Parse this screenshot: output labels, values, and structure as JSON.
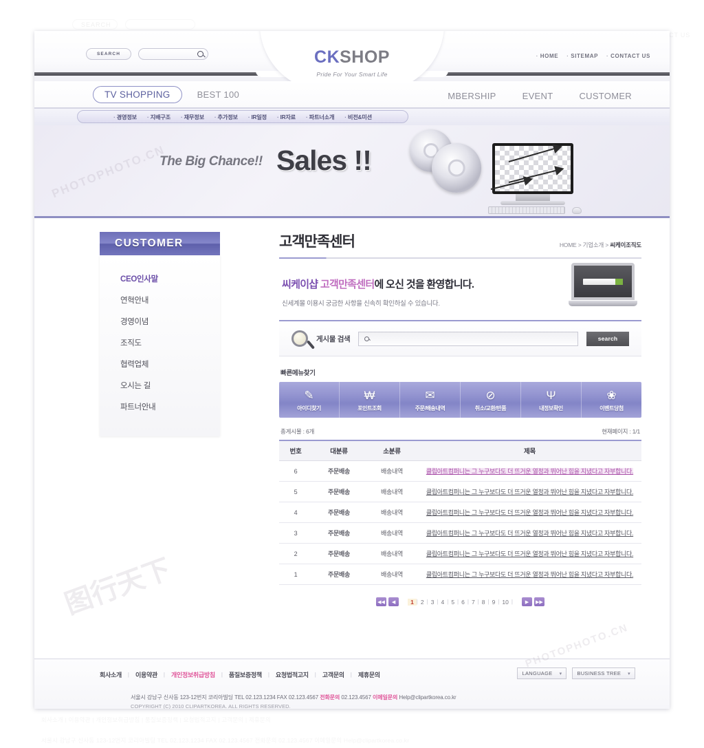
{
  "header": {
    "search_pill": "SEARCH",
    "search_value": "",
    "logo_ck": "CK",
    "logo_shop": "SHOP",
    "tagline": "Pride For Your Smart Life",
    "top_links": [
      "HOME",
      "SITEMAP",
      "CONTACT US"
    ]
  },
  "nav": {
    "active_tab": "TV SHOPPING",
    "left_items": [
      "BEST 100"
    ],
    "right_items": [
      "MBERSHIP",
      "EVENT",
      "CUSTOMER"
    ],
    "subnav": [
      "경영정보",
      "지배구조",
      "재무정보",
      "추가정보",
      "IR일정",
      "IR자료",
      "파트너소개",
      "비전&미션"
    ]
  },
  "banner": {
    "text1": "The Big Chance!!",
    "text2": "Sales !!"
  },
  "sidebar": {
    "title": "CUSTOMER",
    "items": [
      {
        "label": "CEO인사말",
        "active": true
      },
      {
        "label": "연혁안내",
        "active": false
      },
      {
        "label": "경영이념",
        "active": false
      },
      {
        "label": "조직도",
        "active": false
      },
      {
        "label": "협력업체",
        "active": false
      },
      {
        "label": "오시는 길",
        "active": false
      },
      {
        "label": "파트너안내",
        "active": false
      }
    ]
  },
  "main": {
    "page_title": "고객만족센터",
    "breadcrumb_home": "HOME",
    "breadcrumb_mid": "기업소개",
    "breadcrumb_last": "씨케이조직도",
    "welcome_a": "씨케이샵 ",
    "welcome_b": "고객만족센터",
    "welcome_c": "에 오신 것을 환영합니다.",
    "welcome_sub": "신세계몰 이용시 궁금한 사항을 신속히 확인하실 수 있습니다.",
    "search_label": "게시물 검색",
    "search_value": "",
    "search_button": "search",
    "quick_label": "빠른메뉴찾기",
    "quick_menu": [
      {
        "icon": "document-pencil-icon",
        "glyph": "✎",
        "label": "아이디찾기"
      },
      {
        "icon": "won-point-icon",
        "glyph": "₩",
        "label": "포인트조회"
      },
      {
        "icon": "envelope-at-icon",
        "glyph": "✉",
        "label": "주문/배송내역"
      },
      {
        "icon": "no-card-icon",
        "glyph": "⊘",
        "label": "취소/교환/반품"
      },
      {
        "icon": "sprout-hands-icon",
        "glyph": "Ψ",
        "label": "내정보확인"
      },
      {
        "icon": "gift-box-icon",
        "glyph": "❀",
        "label": "이벤트당첨"
      }
    ],
    "total_label": "총게시물 : 6개",
    "page_label": "현재페이지 : 1/1",
    "table": {
      "headers": [
        "번호",
        "대분류",
        "소분류",
        "제목"
      ],
      "rows": [
        {
          "no": "6",
          "cat": "주문배송",
          "sub": "배송내역",
          "title": "클립아트컴퍼니는 그 누구보다도 더 뜨거운 열정과 뛰어난 힘을 지녔다고 자부합니다.",
          "highlight": true
        },
        {
          "no": "5",
          "cat": "주문배송",
          "sub": "배송내역",
          "title": "클립아트컴퍼니는 그 누구보다도 더 뜨거운 열정과 뛰어난 힘을 지녔다고 자부합니다.",
          "highlight": false
        },
        {
          "no": "4",
          "cat": "주문배송",
          "sub": "배송내역",
          "title": "클립아트컴퍼니는 그 누구보다도 더 뜨거운 열정과 뛰어난 힘을 지녔다고 자부합니다.",
          "highlight": false
        },
        {
          "no": "3",
          "cat": "주문배송",
          "sub": "배송내역",
          "title": "클립아트컴퍼니는 그 누구보다도 더 뜨거운 열정과 뛰어난 힘을 지녔다고 자부합니다.",
          "highlight": false
        },
        {
          "no": "2",
          "cat": "주문배송",
          "sub": "배송내역",
          "title": "클립아트컴퍼니는 그 누구보다도 더 뜨거운 열정과 뛰어난 힘을 지녔다고 자부합니다.",
          "highlight": false
        },
        {
          "no": "1",
          "cat": "주문배송",
          "sub": "배송내역",
          "title": "클립아트컴퍼니는 그 누구보다도 더 뜨거운 열정과 뛰어난 힘을 지녔다고 자부합니다.",
          "highlight": false
        }
      ]
    },
    "pager": {
      "first": "◀◀",
      "prev": "◀",
      "next": "▶",
      "last": "▶▶",
      "pages": [
        "1",
        "2",
        "3",
        "4",
        "5",
        "6",
        "7",
        "8",
        "9",
        "10"
      ],
      "current": "1"
    }
  },
  "footer": {
    "links": [
      {
        "label": "회사소개",
        "pink": false
      },
      {
        "label": "이용약관",
        "pink": false
      },
      {
        "label": "개인정보취급방침",
        "pink": true
      },
      {
        "label": "품질보증정책",
        "pink": false
      },
      {
        "label": "요청법적고지",
        "pink": false
      },
      {
        "label": "고객문의",
        "pink": false
      },
      {
        "label": "제휴문의",
        "pink": false
      }
    ],
    "select_language": "LANGUAGE",
    "select_business": "BUSINESS TREE",
    "address": "서울시 강남구 신사동 123-12번지 코리아빌딩  TEL 02.123.1234   FAX 02.123.4567  ",
    "address_phone_label": "전화문의",
    "address_phone": " 02.123.4567  ",
    "address_email_label": "이메일문의",
    "address_email": " Help@clipartkorea.co.kr",
    "copyright": "COPYRIGHT (C) 2010 CLIPARTKOREA. ALL RIGHTS RESERVED."
  },
  "watermarks": {
    "wm1": "PHOTOPHOTO.CN",
    "wm2": "图行天下",
    "wm3": "PHOTOPHOTO.CN"
  }
}
